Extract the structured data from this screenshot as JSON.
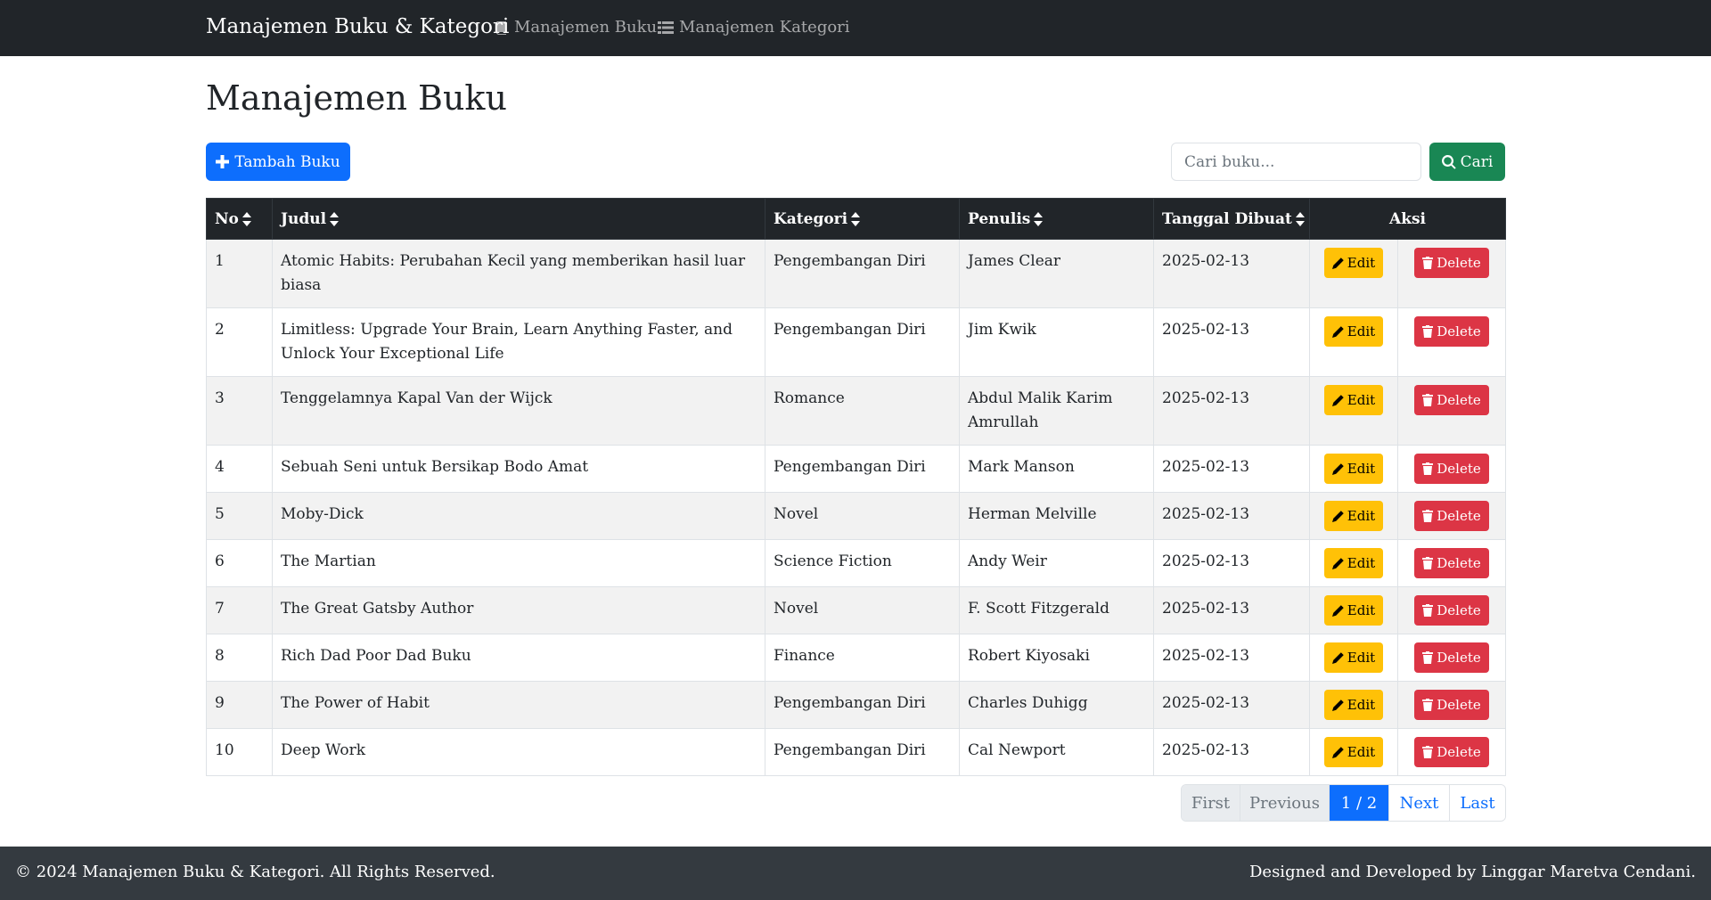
{
  "navbar": {
    "brand": "Manajemen Buku & Kategori",
    "links": [
      {
        "label": "Manajemen Buku",
        "icon": "book-icon"
      },
      {
        "label": "Manajemen Kategori",
        "icon": "list-icon"
      }
    ]
  },
  "page": {
    "title": "Manajemen Buku",
    "add_button_label": "Tambah Buku",
    "search_placeholder": "Cari buku...",
    "search_button_label": "Cari"
  },
  "table": {
    "headers": {
      "no": "No",
      "judul": "Judul",
      "kategori": "Kategori",
      "penulis": "Penulis",
      "tanggal": "Tanggal Dibuat",
      "aksi": "Aksi"
    },
    "edit_label": "Edit",
    "delete_label": "Delete",
    "rows": [
      {
        "no": "1",
        "judul": "Atomic Habits: Perubahan Kecil yang memberikan hasil luar biasa",
        "kategori": "Pengembangan Diri",
        "penulis": "James Clear",
        "tanggal": "2025-02-13"
      },
      {
        "no": "2",
        "judul": "Limitless: Upgrade Your Brain, Learn Anything Faster, and Unlock Your Exceptional Life",
        "kategori": "Pengembangan Diri",
        "penulis": "Jim Kwik",
        "tanggal": "2025-02-13"
      },
      {
        "no": "3",
        "judul": "Tenggelamnya Kapal Van der Wijck",
        "kategori": "Romance",
        "penulis": "Abdul Malik Karim Amrullah",
        "tanggal": "2025-02-13"
      },
      {
        "no": "4",
        "judul": "Sebuah Seni untuk Bersikap Bodo Amat",
        "kategori": "Pengembangan Diri",
        "penulis": "Mark Manson",
        "tanggal": "2025-02-13"
      },
      {
        "no": "5",
        "judul": "Moby-Dick",
        "kategori": "Novel",
        "penulis": "Herman Melville",
        "tanggal": "2025-02-13"
      },
      {
        "no": "6",
        "judul": "The Martian",
        "kategori": "Science Fiction",
        "penulis": "Andy Weir",
        "tanggal": "2025-02-13"
      },
      {
        "no": "7",
        "judul": "The Great Gatsby Author",
        "kategori": "Novel",
        "penulis": "F. Scott Fitzgerald",
        "tanggal": "2025-02-13"
      },
      {
        "no": "8",
        "judul": "Rich Dad Poor Dad Buku",
        "kategori": "Finance",
        "penulis": "Robert Kiyosaki",
        "tanggal": "2025-02-13"
      },
      {
        "no": "9",
        "judul": "The Power of Habit",
        "kategori": "Pengembangan Diri",
        "penulis": "Charles Duhigg",
        "tanggal": "2025-02-13"
      },
      {
        "no": "10",
        "judul": "Deep Work",
        "kategori": "Pengembangan Diri",
        "penulis": "Cal Newport",
        "tanggal": "2025-02-13"
      }
    ]
  },
  "pagination": {
    "first": "First",
    "previous": "Previous",
    "current": "1 / 2",
    "next": "Next",
    "last": "Last"
  },
  "footer": {
    "copyright": "© 2024 Manajemen Buku & Kategori. All Rights Reserved.",
    "credit": "Designed and Developed by Linggar Maretva Cendani."
  },
  "colors": {
    "navbar": "#212529",
    "primary": "#0d6efd",
    "success": "#198754",
    "warning": "#ffc107",
    "danger": "#dc3545",
    "footer": "#343a40"
  }
}
